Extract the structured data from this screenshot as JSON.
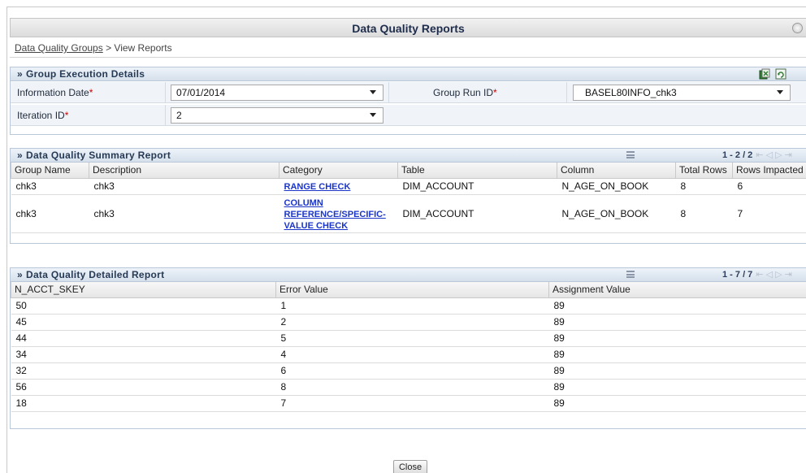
{
  "page": {
    "title": "Data Quality Reports"
  },
  "breadcrumb": {
    "link": "Data Quality Groups",
    "separator": ">",
    "current": "View Reports"
  },
  "group_execution": {
    "header": "Group Execution Details",
    "information_date_label": "Information Date",
    "information_date_value": "07/01/2014",
    "group_run_id_label": "Group Run ID",
    "group_run_id_value": "BASEL80INFO_chk3",
    "iteration_id_label": "Iteration ID",
    "iteration_id_value": "2",
    "required_marker": "*"
  },
  "summary_report": {
    "header": "Data Quality Summary Report",
    "pager": "1 - 2 / 2",
    "columns": [
      "Group Name",
      "Description",
      "Category",
      "Table",
      "Column",
      "Total Rows",
      "Rows Impacted"
    ],
    "rows": [
      {
        "group_name": "chk3",
        "description": "chk3",
        "category": "RANGE CHECK",
        "table": "DIM_ACCOUNT",
        "column": "N_AGE_ON_BOOK",
        "total_rows": "8",
        "rows_impacted": "6"
      },
      {
        "group_name": "chk3",
        "description": "chk3",
        "category": "COLUMN REFERENCE/SPECIFIC-VALUE CHECK",
        "table": "DIM_ACCOUNT",
        "column": "N_AGE_ON_BOOK",
        "total_rows": "8",
        "rows_impacted": "7"
      }
    ]
  },
  "detailed_report": {
    "header": "Data Quality Detailed Report",
    "pager": "1 - 7 / 7",
    "columns": [
      "N_ACCT_SKEY",
      "Error Value",
      "Assignment Value"
    ],
    "rows": [
      {
        "skey": "50",
        "error": "1",
        "assignment": "89"
      },
      {
        "skey": "45",
        "error": "2",
        "assignment": "89"
      },
      {
        "skey": "44",
        "error": "5",
        "assignment": "89"
      },
      {
        "skey": "34",
        "error": "4",
        "assignment": "89"
      },
      {
        "skey": "32",
        "error": "6",
        "assignment": "89"
      },
      {
        "skey": "56",
        "error": "8",
        "assignment": "89"
      },
      {
        "skey": "18",
        "error": "7",
        "assignment": "89"
      }
    ]
  },
  "buttons": {
    "close": "Close"
  },
  "icons": {
    "help": "help-icon",
    "export_excel": "excel-export-icon",
    "export_refresh": "refresh-export-icon",
    "menu": "column-menu-icon",
    "pager_nav": "pagination-arrows-icon"
  }
}
